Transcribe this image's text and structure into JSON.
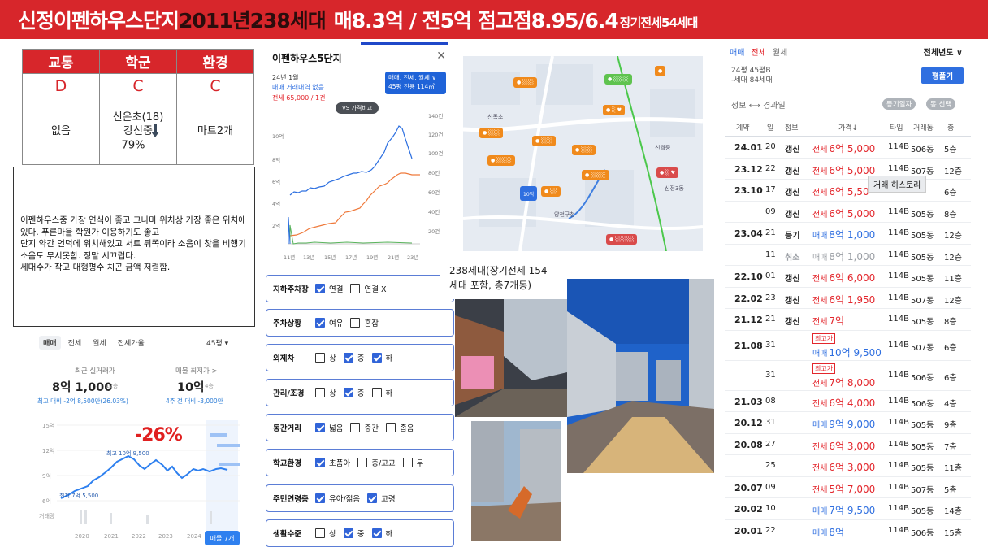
{
  "header": {
    "name": "신정이펜하우스단지",
    "year_units": "2011년238세대",
    "prices": "매8.3억 / 전5억 점고점8.95/6.4",
    "lease_note": "장기전세54세대"
  },
  "rating": {
    "headers": [
      "교통",
      "학군",
      "환경"
    ],
    "grades": [
      "D",
      "C",
      "C"
    ],
    "values": [
      "없음",
      "신은초(18)\n강신중\n79%",
      "마트2개"
    ]
  },
  "comment": "이펜하우스중 가장 연식이 좋고 그나마 위치상 가장 좋은 위치에 있다. 푸른마을 학원가 이용하기도 좋고\n단지 약간 언덕에 위치해있고 서트 뒤쪽이라 소음이 찾을 비행기 소음도 무시못함. 정말 시끄럽다.\n세대수가 작고 대형평수 치곤 금액 저렴함.",
  "price_panel": {
    "tabs": [
      "매매",
      "전세",
      "월세",
      "전세가율"
    ],
    "size_select": "45평 ▾",
    "recent_label": "최근 실거래가",
    "recent_price": "8억 1,000",
    "recent_suffix": "12층",
    "recent_diff": "최고 대비 -2억 8,500만(26.03%)",
    "listing_label": "매물 최저가 >",
    "listing_price": "10억",
    "listing_suffix": "4층",
    "listing_diff": "4주 전 대비 -3,000만",
    "drop": "-26%",
    "high_label": "최고 10억 9,500",
    "low_label": "최저 7억 5,500",
    "ylabels": [
      "15억",
      "12억",
      "9억",
      "6억"
    ],
    "vol_label": "거래량",
    "years": [
      "2020",
      "2021",
      "2022",
      "2023",
      "2024"
    ],
    "button": "매물 7개"
  },
  "dialog": {
    "title": "이펜하우스5단지",
    "month": "24년 1월",
    "no_trade": "매매 거래내역 없음",
    "lease": "전세 65,000 / 1건",
    "tag_line1": "매매, 전세, 월세 ∨",
    "tag_line2": "45평  전용 114㎡",
    "vs": "VS 가격비교",
    "left_ticks": [
      "10억",
      "8억",
      "6억",
      "4억",
      "2억"
    ],
    "right_ticks": [
      "140건",
      "120건",
      "100건",
      "80건",
      "60건",
      "40건",
      "20건"
    ],
    "x_ticks": [
      "11년",
      "13년",
      "15년",
      "17년",
      "19년",
      "21년",
      "23년"
    ]
  },
  "checklist": [
    {
      "key": "지하주차장",
      "options": [
        [
          "연결",
          true
        ],
        [
          "연결 X",
          false
        ]
      ]
    },
    {
      "key": "주차상황",
      "options": [
        [
          "여유",
          true
        ],
        [
          "혼잡",
          false
        ]
      ]
    },
    {
      "key": "외제차",
      "options": [
        [
          "상",
          false
        ],
        [
          "중",
          true
        ],
        [
          "하",
          true
        ]
      ]
    },
    {
      "key": "관리/조경",
      "options": [
        [
          "상",
          false
        ],
        [
          "중",
          true
        ],
        [
          "하",
          false
        ]
      ]
    },
    {
      "key": "동간거리",
      "options": [
        [
          "넓음",
          true
        ],
        [
          "중간",
          false
        ],
        [
          "좁음",
          false
        ]
      ]
    },
    {
      "key": "학교환경",
      "options": [
        [
          "초품아",
          true
        ],
        [
          "중/고교",
          false
        ],
        [
          "무",
          false
        ]
      ]
    },
    {
      "key": "주민연령층",
      "options": [
        [
          "유아/젊음",
          true
        ],
        [
          "고령",
          true
        ]
      ]
    },
    {
      "key": "생활수준",
      "options": [
        [
          "상",
          false
        ],
        [
          "중",
          true
        ],
        [
          "하",
          true
        ]
      ]
    }
  ],
  "caption": "238세대(장기전세 154\n세대 포함, 총7개동)",
  "tx": {
    "tabs": [
      "매매",
      "전세",
      "월세"
    ],
    "year_filter": "전체년도 ∨",
    "info1": "24평   45평B",
    "info2": "-세대   84세대",
    "size_button": "평풀기",
    "sub_left": "정보 ⟷ 경과일",
    "chip1": "등기일자",
    "chip2": "동 선택",
    "columns": [
      "계약",
      "일",
      "정보",
      "가격↓",
      "타입",
      "거래동",
      "층"
    ],
    "tooltip": "거래 히스토리",
    "rows": [
      {
        "ym": "24.01",
        "d": "20",
        "k": "갱신",
        "t": "전세",
        "p": "6억 5,000",
        "ty": "114B",
        "dn": "506동",
        "fl": "5층"
      },
      {
        "ym": "23.12",
        "d": "22",
        "k": "갱신",
        "t": "전세",
        "p": "6억 5,000",
        "ty": "114B",
        "dn": "507동",
        "fl": "12층"
      },
      {
        "ym": "23.10",
        "d": "17",
        "k": "갱신",
        "t": "전세",
        "p": "6억 5,50",
        "ty": "",
        "dn": "",
        "fl": "6층"
      },
      {
        "ym": "",
        "d": "09",
        "k": "갱신",
        "t": "전세",
        "p": "6억 5,000",
        "ty": "114B",
        "dn": "505동",
        "fl": "8층"
      },
      {
        "ym": "23.04",
        "d": "21",
        "k": "등기",
        "t": "매매",
        "p": "8억 1,000",
        "ty": "114B",
        "dn": "505동",
        "fl": "12층"
      },
      {
        "ym": "",
        "d": "11",
        "k": "취소",
        "t": "매매",
        "p": "8억 1,000",
        "ty": "114B",
        "dn": "505동",
        "fl": "12층"
      },
      {
        "ym": "22.10",
        "d": "01",
        "k": "갱신",
        "t": "전세",
        "p": "6억 6,000",
        "ty": "114B",
        "dn": "505동",
        "fl": "11층"
      },
      {
        "ym": "22.02",
        "d": "23",
        "k": "갱신",
        "t": "전세",
        "p": "6억 1,950",
        "ty": "114B",
        "dn": "507동",
        "fl": "12층"
      },
      {
        "ym": "21.12",
        "d": "21",
        "k": "갱신",
        "t": "전세",
        "p": "7억",
        "ty": "114B",
        "dn": "505동",
        "fl": "8층"
      },
      {
        "ym": "21.08",
        "d": "31",
        "k": "",
        "badge": "최고가",
        "t": "매매",
        "p": "10억 9,500",
        "ty": "114B",
        "dn": "507동",
        "fl": "6층"
      },
      {
        "ym": "",
        "d": "31",
        "k": "",
        "badge": "최고가",
        "t": "전세",
        "p": "7억 8,000",
        "ty": "114B",
        "dn": "506동",
        "fl": "6층"
      },
      {
        "ym": "21.03",
        "d": "08",
        "k": "",
        "t": "전세",
        "p": "6억 4,000",
        "ty": "114B",
        "dn": "506동",
        "fl": "4층"
      },
      {
        "ym": "20.12",
        "d": "31",
        "k": "",
        "t": "매매",
        "p": "9억 9,000",
        "ty": "114B",
        "dn": "505동",
        "fl": "9층"
      },
      {
        "ym": "20.08",
        "d": "27",
        "k": "",
        "t": "전세",
        "p": "6억 3,000",
        "ty": "114B",
        "dn": "505동",
        "fl": "7층"
      },
      {
        "ym": "",
        "d": "25",
        "k": "",
        "t": "전세",
        "p": "6억 3,000",
        "ty": "114B",
        "dn": "505동",
        "fl": "11층"
      },
      {
        "ym": "20.07",
        "d": "09",
        "k": "",
        "t": "전세",
        "p": "5억 7,000",
        "ty": "114B",
        "dn": "507동",
        "fl": "5층"
      },
      {
        "ym": "20.02",
        "d": "10",
        "k": "",
        "t": "매매",
        "p": "7억 9,500",
        "ty": "114B",
        "dn": "505동",
        "fl": "14층"
      },
      {
        "ym": "20.01",
        "d": "22",
        "k": "",
        "t": "매매",
        "p": "8억",
        "ty": "114B",
        "dn": "506동",
        "fl": "15층"
      }
    ]
  },
  "map_labels": [
    "신정3동",
    "양천구청",
    "신목초",
    "신월중"
  ],
  "colors": {
    "brand_red": "#d7262b",
    "blue": "#2f6fe0",
    "orange": "#f08a1c"
  }
}
